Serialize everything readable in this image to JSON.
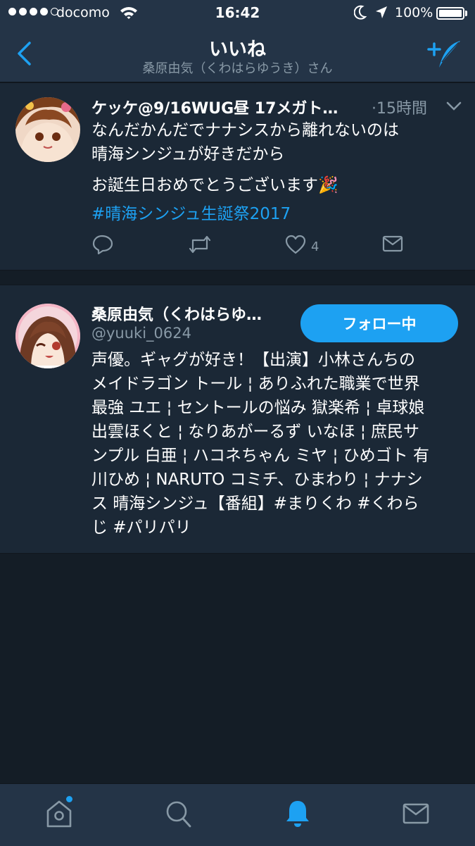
{
  "status_bar": {
    "carrier": "docomo",
    "time": "16:42",
    "battery": "100%"
  },
  "nav": {
    "title": "いいね",
    "subtitle": "桑原由気（くわはらゆうき）さん"
  },
  "tweet": {
    "author": "ケッケ@9/16WUG昼 17メガト…",
    "time": "·15時間",
    "lines": [
      "なんだかんだでナナシスから離れないのは",
      "晴海シンジュが好きだから",
      "お誕生日おめでとうございます🎉"
    ],
    "hashtag": "#晴海シンジュ生誕祭2017",
    "like_count": "4"
  },
  "profile": {
    "name": "桑原由気（くわはらゆ…",
    "handle": "@yuuki_0624",
    "follow_label": "フォロー中",
    "bio_lines": [
      "声優。ギャグが好き！【出演】小林さんちの",
      "メイドラゴン トール ¦ ありふれた職業で世界",
      "最強 ユエ ¦ セントールの悩み 獄楽希 ¦ 卓球娘",
      "出雲ほくと ¦ なりあがーるず いなほ ¦ 庶民サ",
      "ンプル 白亜 ¦ ハコネちゃん ミヤ ¦ ひめゴト 有",
      "川ひめ ¦ NARUTO コミチ、ひまわり ¦ ナナシ",
      "ス 晴海シンジュ【番組】#まりくわ #くわら",
      "じ #パリパリ"
    ]
  },
  "colors": {
    "accent": "#1da1f2",
    "background": "#141d26",
    "card": "#1b2836",
    "bar": "#243447",
    "muted": "#8899a6"
  },
  "icons": [
    "back-icon",
    "compose-icon",
    "reply-icon",
    "retweet-icon",
    "like-icon",
    "dm-icon",
    "home-icon",
    "search-icon",
    "notifications-icon",
    "messages-icon"
  ]
}
